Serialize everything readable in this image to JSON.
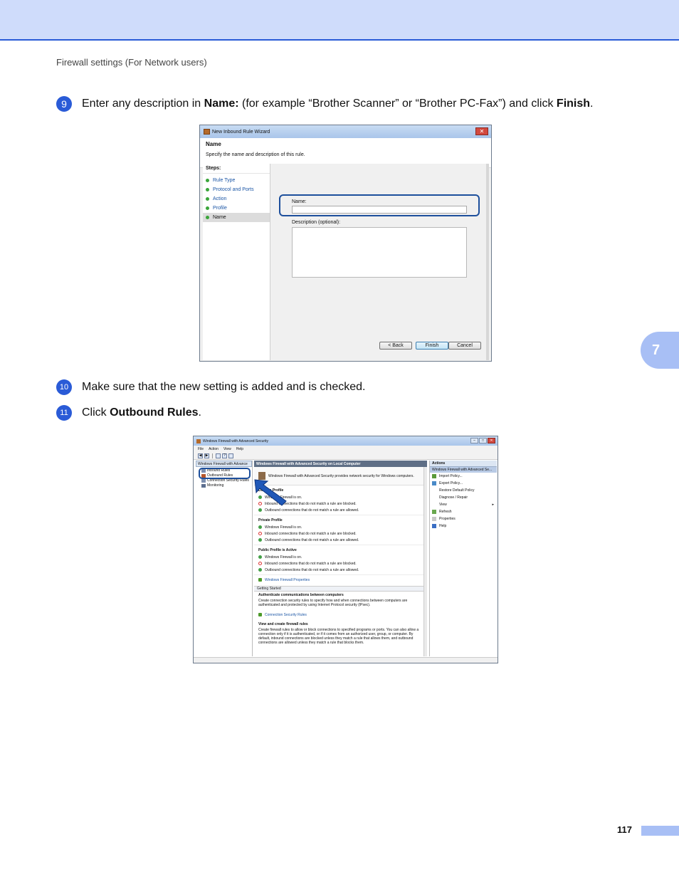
{
  "header": {
    "running_title": "Firewall settings (For Network users)"
  },
  "chapter_tab": "7",
  "steps": [
    {
      "number": "9",
      "pre": "Enter any description in ",
      "bold1": "Name:",
      "mid": " (for example “Brother Scanner” or “Brother PC-Fax”) and click ",
      "bold2": "Finish",
      "post": "."
    },
    {
      "number": "10",
      "text": "Make sure that the new setting is added and is checked."
    },
    {
      "number": "11",
      "pre": "Click ",
      "bold": "Outbound Rules",
      "post": "."
    }
  ],
  "wizard": {
    "title": "New Inbound Rule Wizard",
    "heading": "Name",
    "subheading": "Specify the name and description of this rule.",
    "steps_label": "Steps:",
    "steps": [
      "Rule Type",
      "Protocol and Ports",
      "Action",
      "Profile",
      "Name"
    ],
    "name_label": "Name:",
    "name_value": "",
    "description_label": "Description (optional):",
    "buttons": {
      "back": "< Back",
      "finish": "Finish",
      "cancel": "Cancel"
    }
  },
  "firewall": {
    "title": "Windows Firewall with Advanced Security",
    "menu": [
      "File",
      "Action",
      "View",
      "Help"
    ],
    "tree_header": "Windows Firewall with Advance",
    "tree": [
      "Inbound Rules",
      "Outbound Rules",
      "Connection Security Rules",
      "Monitoring"
    ],
    "center_header": "Windows Firewall with Advanced Security on Local Computer",
    "intro": "Windows Firewall with Advanced Security provides network security for Windows computers.",
    "profiles": [
      {
        "title": "Domain Profile",
        "rows": [
          "Windows Firewall is on.",
          "Inbound connections that do not match a rule are blocked.",
          "Outbound connections that do not match a rule are allowed."
        ]
      },
      {
        "title": "Private Profile",
        "rows": [
          "Windows Firewall is on.",
          "Inbound connections that do not match a rule are blocked.",
          "Outbound connections that do not match a rule are allowed."
        ]
      },
      {
        "title": "Public Profile is Active",
        "rows": [
          "Windows Firewall is on.",
          "Inbound connections that do not match a rule are blocked.",
          "Outbound connections that do not match a rule are allowed."
        ]
      }
    ],
    "properties_link": "Windows Firewall Properties",
    "getting_started": "Getting Started",
    "auth_title": "Authenticate communications between computers",
    "auth_text": "Create connection security rules to specify how and when connections between computers are authenticated and protected by using Internet Protocol security (IPsec).",
    "conn_link": "Connection Security Rules",
    "view_title": "View and create firewall rules",
    "view_text": "Create firewall rules to allow or block connections to specified programs or ports. You can also allow a connection only if it is authenticated, or if it comes from an authorized user, group, or computer. By default, inbound connections are blocked unless they match a rule that allows them, and outbound connections are allowed unless they match a rule that blocks them.",
    "actions_header": "Actions",
    "actions_sub": "Windows Firewall with Advanced Se...",
    "actions": [
      "Import Policy...",
      "Export Policy...",
      "Restore Default Policy",
      "Diagnose / Repair",
      "View",
      "Refresh",
      "Properties",
      "Help"
    ]
  },
  "page_number": "117",
  "colors": {
    "accent": "#2a5bd7",
    "band": "#cfdcfb",
    "tab": "#a8bff5",
    "highlight": "#1d4f9c"
  }
}
